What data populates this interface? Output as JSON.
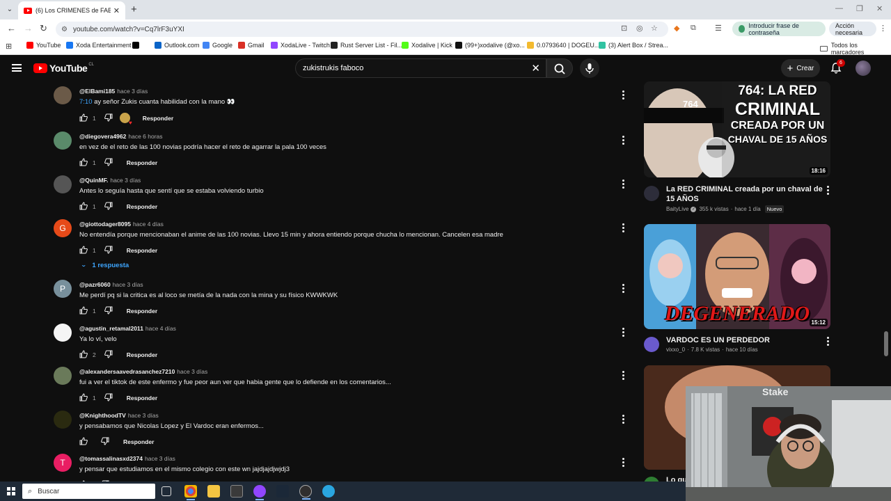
{
  "browser": {
    "tab_title": "(6) Los CRIMENES de FABOCO |",
    "url": "youtube.com/watch?v=Cq7lrF3uYXI",
    "password_pill": "Introducir frase de contraseña",
    "action_pill": "Acción necesaria",
    "bookmarks": [
      {
        "label": "YouTube",
        "color": "#ff0000"
      },
      {
        "label": "Xoda Entertainment",
        "color": "#1877f2"
      },
      {
        "label": "",
        "color": "#000000"
      },
      {
        "label": "Outlook.com",
        "color": "#0a64c8"
      },
      {
        "label": "Google",
        "color": "#4285f4"
      },
      {
        "label": "Gmail",
        "color": "#d93025"
      },
      {
        "label": "XodaLive - Twitch",
        "color": "#9146ff"
      },
      {
        "label": "Rust Server List - Fil...",
        "color": "#222222"
      },
      {
        "label": "Xodalive | Kick",
        "color": "#53fc18"
      },
      {
        "label": "(99+)xodalive (@xo...",
        "color": "#111111"
      },
      {
        "label": "0.0793640 | DOGEU...",
        "color": "#f3ba2f"
      },
      {
        "label": "(3) Alert Box / Strea...",
        "color": "#31c3a2"
      }
    ],
    "all_bookmarks": "Todos los marcadores"
  },
  "youtube": {
    "logo_text": "YouTube",
    "country_code": "CL",
    "search_query": "zukistrukis faboco",
    "create_label": "Crear",
    "notification_count": "6"
  },
  "comments": [
    {
      "user": "@ElBami185",
      "time": "hace 3 días",
      "timestamp": "7:10",
      "text": " ay señor Zukis cuanta habilidad con la mano 👀",
      "likes": "1",
      "reply": "Responder",
      "avatar_color": "#6b5a48",
      "avatar_letter": "",
      "creator_heart": true
    },
    {
      "user": "@diegovera4962",
      "time": "hace 6 horas",
      "timestamp": "",
      "text": "en vez de el reto de las 100 novias podría hacer el reto de agarrar la pala 100 veces",
      "likes": "1",
      "reply": "Responder",
      "avatar_color": "#5a8a6a",
      "avatar_letter": "",
      "creator_heart": false
    },
    {
      "user": "@QuinMF.",
      "time": "hace 3 días",
      "timestamp": "",
      "text": "Antes lo seguía hasta que sentí que se estaba volviendo turbio",
      "likes": "1",
      "reply": "Responder",
      "avatar_color": "#555555",
      "avatar_letter": "",
      "creator_heart": false
    },
    {
      "user": "@giottodager8095",
      "time": "hace 4 días",
      "timestamp": "",
      "text": "No entendía porque mencionaban el anime de las 100 novias. Llevo 15 min y ahora entiendo porque chucha lo mencionan. Cancelen esa madre",
      "likes": "1",
      "reply": "Responder",
      "avatar_color": "#e64a19",
      "avatar_letter": "G",
      "creator_heart": false,
      "replies": "1 respuesta"
    },
    {
      "user": "@pazr6060",
      "time": "hace 3 días",
      "timestamp": "",
      "text": "Me perdí pq si la critica es al loco se metía de la nada con la mina y su físico KWWKWK",
      "likes": "1",
      "reply": "Responder",
      "avatar_color": "#78909c",
      "avatar_letter": "P",
      "creator_heart": false
    },
    {
      "user": "@agustin_retamal2011",
      "time": "hace 4 días",
      "timestamp": "",
      "text": "Ya lo ví, velo",
      "likes": "2",
      "reply": "Responder",
      "avatar_color": "#f5f5f5",
      "avatar_letter": "",
      "creator_heart": false
    },
    {
      "user": "@alexandersaavedrasanchez7210",
      "time": "hace 3 días",
      "timestamp": "",
      "text": "fui a ver el tiktok de este enfermo y fue peor aun ver que habia gente que lo defiende en los comentarios...",
      "likes": "1",
      "reply": "Responder",
      "avatar_color": "#6a7a5a",
      "avatar_letter": "",
      "creator_heart": false
    },
    {
      "user": "@KnighthoodTV",
      "time": "hace 3 días",
      "timestamp": "",
      "text": "y pensabamos que Nicolas Lopez y El Vardoc eran enfermos...",
      "likes": "",
      "reply": "Responder",
      "avatar_color": "#2a2a10",
      "avatar_letter": "",
      "creator_heart": false
    },
    {
      "user": "@tomassalinasxd2374",
      "time": "hace 3 días",
      "timestamp": "",
      "text": "y pensar que estudiamos en el mismo colegio con este wn jajdjajdjwjdj3",
      "likes": "",
      "reply": "Responder",
      "avatar_color": "#e91e63",
      "avatar_letter": "T",
      "creator_heart": false
    }
  ],
  "recommendations": [
    {
      "title": "La RED CRIMINAL creada por un chaval de 15 AÑOS",
      "channel": "BaityLive",
      "verified": true,
      "views": "355 k vistas",
      "age": "hace 1 día",
      "badge": "Nuevo",
      "duration": "18:16",
      "thumb_text": [
        "764: LA RED",
        "CRIMINAL",
        "CREADA POR UN",
        "CHAVAL DE 15 AÑOS"
      ],
      "thumb_logo": "764"
    },
    {
      "title": "VARDOC ES UN PERDEDOR",
      "channel": "vixxo_0",
      "verified": false,
      "views": "7.8 K vistas",
      "age": "hace 10 días",
      "badge": "",
      "duration": "15:12",
      "thumb_text": [
        "DEGENERADO"
      ],
      "thumb_logo": ""
    },
    {
      "title": "Lo qu",
      "channel": "",
      "verified": false,
      "views": "",
      "age": "",
      "badge": "",
      "duration": "",
      "thumb_text": [],
      "thumb_logo": ""
    }
  ],
  "webcam": {
    "sign_text": "Stake"
  },
  "taskbar": {
    "search_label": "Buscar"
  }
}
